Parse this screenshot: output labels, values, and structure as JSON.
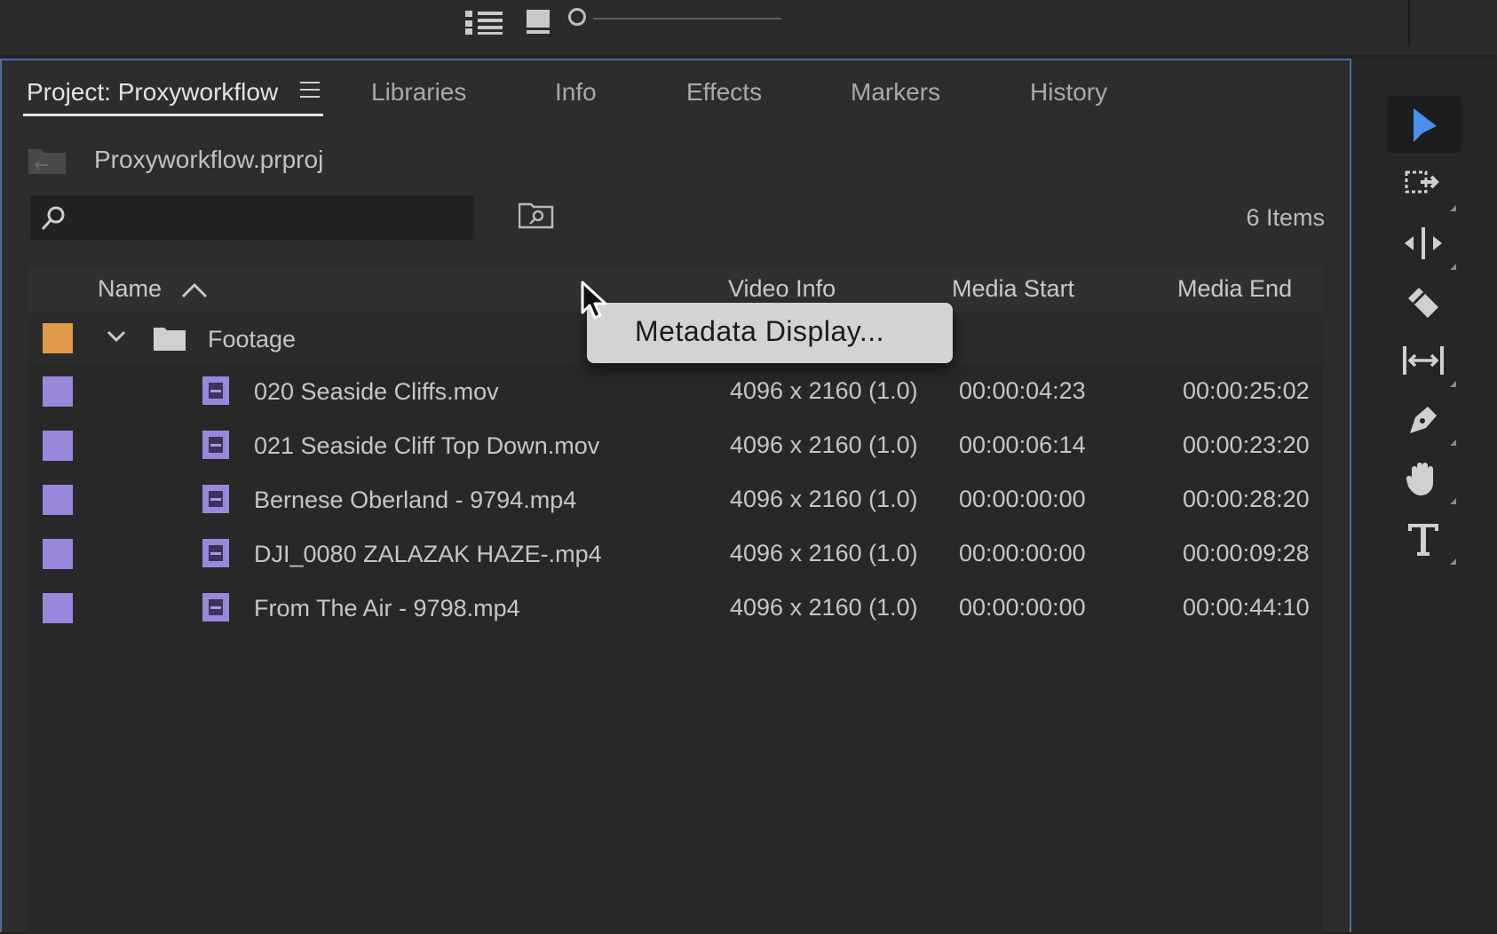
{
  "toolbar_top": {
    "icons": [
      "list-view-icon",
      "icon-view-icon",
      "zoom-slider"
    ]
  },
  "tabs": [
    {
      "label": "Project: Proxyworkflow",
      "active": true
    },
    {
      "label": "Libraries"
    },
    {
      "label": "Info"
    },
    {
      "label": "Effects"
    },
    {
      "label": "Markers"
    },
    {
      "label": "History"
    }
  ],
  "project": {
    "file": "Proxyworkflow.prproj",
    "items_count": "6 Items",
    "search_placeholder": ""
  },
  "columns": {
    "name": "Name",
    "video_info": "Video Info",
    "media_start": "Media Start",
    "media_end": "Media End"
  },
  "folder": {
    "name": "Footage",
    "label_color": "#e19a48"
  },
  "clips": [
    {
      "name": "020 Seaside Cliffs.mov",
      "video_info": "4096 x 2160 (1.0)",
      "media_start": "00:00:04:23",
      "media_end": "00:00:25:02"
    },
    {
      "name": "021 Seaside Cliff Top Down.mov",
      "video_info": "4096 x 2160 (1.0)",
      "media_start": "00:00:06:14",
      "media_end": "00:00:23:20"
    },
    {
      "name": "Bernese Oberland - 9794.mp4",
      "video_info": "4096 x 2160 (1.0)",
      "media_start": "00:00:00:00",
      "media_end": "00:00:28:20"
    },
    {
      "name": "DJI_0080 ZALAZAK HAZE-.mp4",
      "video_info": "4096 x 2160 (1.0)",
      "media_start": "00:00:00:00",
      "media_end": "00:00:09:28"
    },
    {
      "name": "From The Air - 9798.mp4",
      "video_info": "4096 x 2160 (1.0)",
      "media_start": "00:00:00:00",
      "media_end": "00:00:44:10"
    }
  ],
  "clip_label_color": "#9a86dc",
  "context_menu": {
    "item": "Metadata Display..."
  },
  "tools": [
    "selection-tool-icon",
    "track-select-tool-icon",
    "ripple-edit-tool-icon",
    "razor-tool-icon",
    "slip-tool-icon",
    "pen-tool-icon",
    "hand-tool-icon",
    "type-tool-icon"
  ],
  "accent_color": "#4a8fe8"
}
